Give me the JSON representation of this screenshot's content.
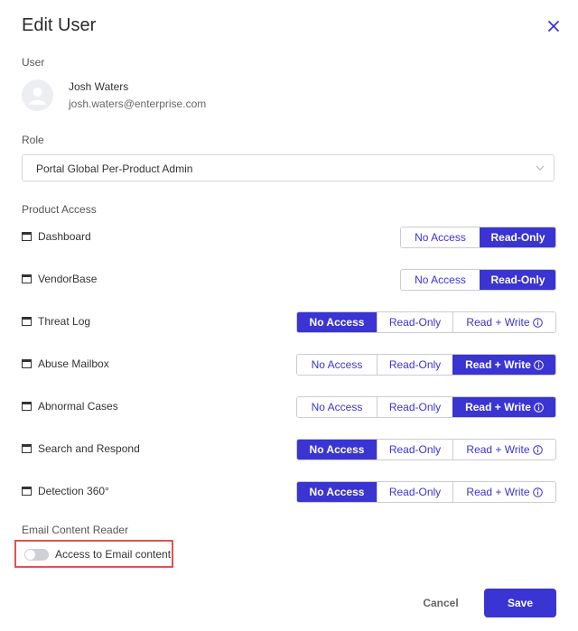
{
  "modal": {
    "title": "Edit User",
    "close_icon": "close-x-icon"
  },
  "user_section": {
    "label": "User",
    "name": "Josh Waters",
    "email": "josh.waters@enterprise.com"
  },
  "role_section": {
    "label": "Role",
    "selected": "Portal Global Per-Product Admin"
  },
  "product_access": {
    "label": "Product Access",
    "products": [
      {
        "name": "Dashboard",
        "options": [
          "No Access",
          "Read-Only"
        ],
        "selected": "Read-Only"
      },
      {
        "name": "VendorBase",
        "options": [
          "No Access",
          "Read-Only"
        ],
        "selected": "Read-Only"
      },
      {
        "name": "Threat Log",
        "options": [
          "No Access",
          "Read-Only",
          "Read + Write"
        ],
        "selected": "No Access"
      },
      {
        "name": "Abuse Mailbox",
        "options": [
          "No Access",
          "Read-Only",
          "Read + Write"
        ],
        "selected": "Read + Write"
      },
      {
        "name": "Abnormal Cases",
        "options": [
          "No Access",
          "Read-Only",
          "Read + Write"
        ],
        "selected": "Read + Write"
      },
      {
        "name": "Search and Respond",
        "options": [
          "No Access",
          "Read-Only",
          "Read + Write"
        ],
        "selected": "No Access"
      },
      {
        "name": "Detection 360°",
        "options": [
          "No Access",
          "Read-Only",
          "Read + Write"
        ],
        "selected": "No Access"
      }
    ]
  },
  "email_reader": {
    "label": "Email Content Reader",
    "toggle_label": "Access to Email content",
    "enabled": false
  },
  "footer": {
    "cancel_label": "Cancel",
    "save_label": "Save"
  },
  "colors": {
    "accent": "#3a34d2",
    "highlight_border": "#e05252"
  }
}
